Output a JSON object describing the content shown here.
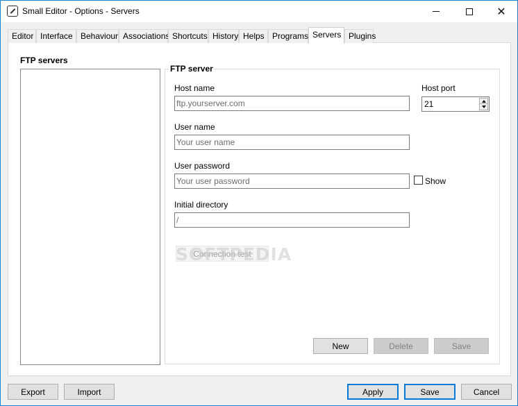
{
  "window": {
    "title": "Small Editor - Options - Servers",
    "controls": {
      "minimize": "—",
      "maximize": "□",
      "close": "✕"
    }
  },
  "tabs": [
    {
      "label": "Editor"
    },
    {
      "label": "Interface"
    },
    {
      "label": "Behaviour"
    },
    {
      "label": "Associations"
    },
    {
      "label": "Shortcuts"
    },
    {
      "label": "History"
    },
    {
      "label": "Helps"
    },
    {
      "label": "Programs"
    },
    {
      "label": "Servers",
      "active": true
    },
    {
      "label": "Plugins"
    }
  ],
  "servers_panel": {
    "title": "FTP servers"
  },
  "server_form": {
    "group_title": "FTP server",
    "host_name": {
      "label": "Host name",
      "placeholder": "ftp.yourserver.com",
      "value": ""
    },
    "host_port": {
      "label": "Host port",
      "value": "21"
    },
    "user_name": {
      "label": "User name",
      "placeholder": "Your user name",
      "value": ""
    },
    "user_password": {
      "label": "User password",
      "placeholder": "Your user password",
      "value": ""
    },
    "show_label": "Show",
    "show_checked": false,
    "initial_directory": {
      "label": "Initial directory",
      "value": "/"
    },
    "connection_test_label": "Connection test",
    "new_label": "New",
    "delete_label": "Delete",
    "save_label": "Save"
  },
  "watermark": "SOFTPEDIA",
  "footer": {
    "export_label": "Export",
    "import_label": "Import",
    "apply_label": "Apply",
    "save_label": "Save",
    "cancel_label": "Cancel"
  },
  "colors": {
    "accent": "#0078d7",
    "window_border": "#1883d7",
    "background": "#f0f0f0",
    "panel": "#ffffff"
  }
}
